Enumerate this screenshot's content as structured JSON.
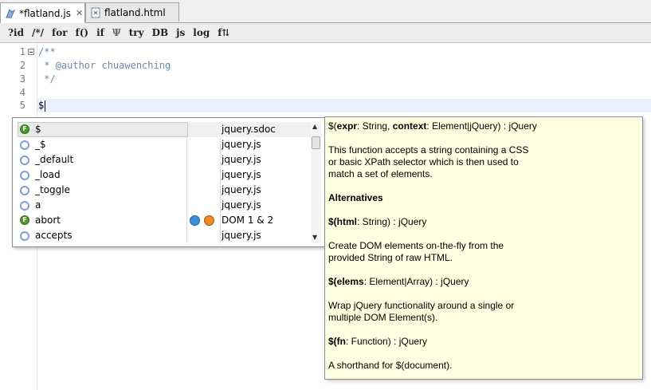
{
  "tabs": [
    {
      "label": "*flatland.js",
      "close": "✕"
    },
    {
      "label": "flatland.html"
    }
  ],
  "toolbar": [
    "?id",
    "/*/",
    "for",
    "f()",
    "if",
    "Ψ",
    "try",
    "DB",
    "js",
    "log",
    "f⇅"
  ],
  "code_lines": [
    {
      "num": "1",
      "text": "/**"
    },
    {
      "num": "2",
      "text": " * @author chuawenching"
    },
    {
      "num": "3",
      "text": " */"
    },
    {
      "num": "4",
      "text": ""
    },
    {
      "num": "5",
      "text": "$"
    }
  ],
  "completions": [
    {
      "icon": "function-icon",
      "name": "$",
      "source": "jquery.sdoc"
    },
    {
      "icon": "object-icon",
      "name": "_$",
      "source": "jquery.js"
    },
    {
      "icon": "object-icon",
      "name": "_default",
      "source": "jquery.js"
    },
    {
      "icon": "object-icon",
      "name": "_load",
      "source": "jquery.js"
    },
    {
      "icon": "object-icon",
      "name": "_toggle",
      "source": "jquery.js"
    },
    {
      "icon": "object-icon",
      "name": "a",
      "source": "jquery.js"
    },
    {
      "icon": "function-icon",
      "name": "abort",
      "source": "DOM 1 & 2"
    },
    {
      "icon": "object-icon",
      "name": "accepts",
      "source": "jquery.js"
    }
  ],
  "doc": {
    "sig1_a": "$(",
    "sig1_b": "expr",
    "sig1_c": ": String, ",
    "sig1_d": "context",
    "sig1_e": ": Element|jQuery) : jQuery",
    "desc1_l1": "This function accepts a string containing a CSS",
    "desc1_l2": "or basic XPath selector which is then used to",
    "desc1_l3": "match a set of elements.",
    "alternatives": "Alternatives",
    "sig2_a": "$(",
    "sig2_b": "html",
    "sig2_c": ": String) : jQuery",
    "desc2_l1": "Create DOM elements on-the-fly from the",
    "desc2_l2": "provided String of raw HTML.",
    "sig3_a": "$(",
    "sig3_b": "elems",
    "sig3_c": ": Element|Array) : jQuery",
    "desc3_l1": "Wrap jQuery functionality around a single or",
    "desc3_l2": "multiple DOM Element(s).",
    "sig4_a": "$(",
    "sig4_b": "fn",
    "sig4_c": ": Function) : jQuery",
    "desc4_l1": "A shorthand for $(document)."
  }
}
